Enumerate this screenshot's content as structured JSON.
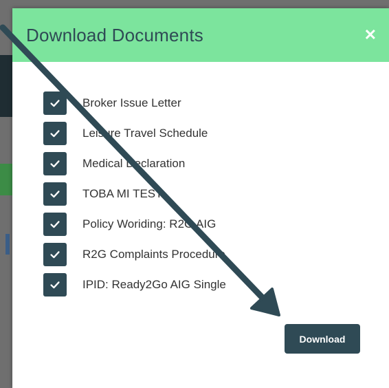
{
  "modal": {
    "title": "Download Documents",
    "close_icon": "close-icon",
    "documents": [
      {
        "label": "Broker Issue Letter",
        "checked": true
      },
      {
        "label": "Leisure Travel Schedule",
        "checked": true
      },
      {
        "label": "Medical Declaration",
        "checked": true
      },
      {
        "label": "TOBA MI TEST",
        "checked": true
      },
      {
        "label": "Policy Woriding: R2G AIG",
        "checked": true
      },
      {
        "label": "R2G Complaints Procedure",
        "checked": true
      },
      {
        "label": "IPID: Ready2Go AIG Single",
        "checked": true
      }
    ],
    "download_label": "Download"
  },
  "colors": {
    "header": "#7ce49d",
    "accent": "#2f4a55",
    "arrow": "#2f4a55"
  }
}
